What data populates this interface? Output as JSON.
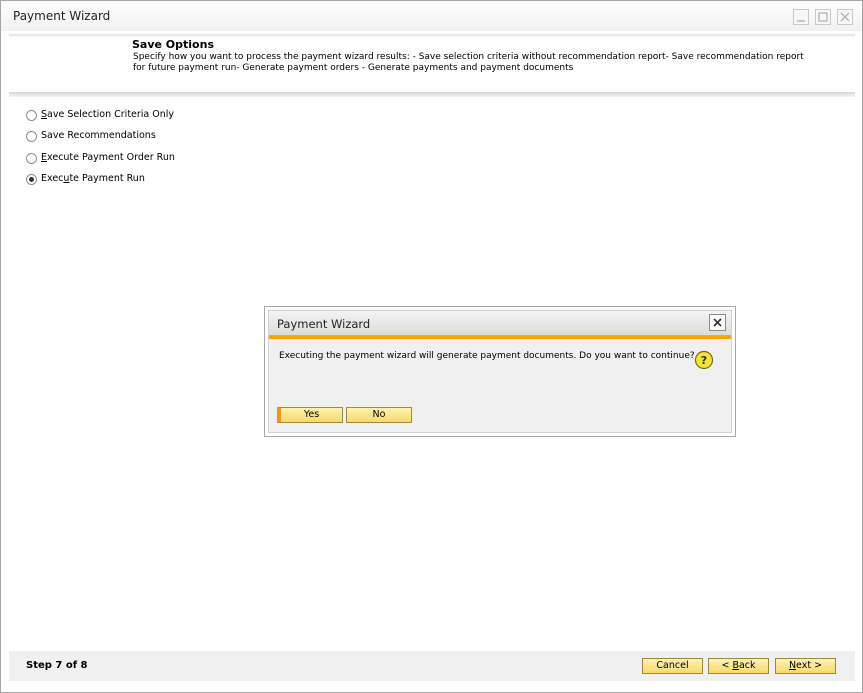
{
  "window": {
    "title": "Payment Wizard"
  },
  "header": {
    "title": "Save Options",
    "description": "Specify how you want to process the payment wizard results: - Save selection criteria without recommendation report- Save recommendation report for future payment run- Generate payment orders - Generate payments and payment documents"
  },
  "options": [
    {
      "label_first": "S",
      "label_rest": "ave Selection Criteria Only",
      "checked": false
    },
    {
      "label_first": "S",
      "label_rest": "ave Recommendations",
      "checked": false
    },
    {
      "label_first": "E",
      "label_rest": "xecute Payment Order Run",
      "checked": false
    },
    {
      "label_pre": "Exec",
      "label_first": "u",
      "label_rest": "te Payment Run",
      "checked": true
    }
  ],
  "footer": {
    "step": "Step 7 of 8",
    "cancel": "Cancel",
    "back_pre": "< ",
    "back_ul": "B",
    "back_rest": "ack",
    "next_ul": "N",
    "next_rest": "ext >"
  },
  "dialog": {
    "title": "Payment Wizard",
    "message": "Executing the payment wizard will generate payment documents. Do you want to continue?",
    "yes": "Yes",
    "no": "No"
  },
  "colors": {
    "accent_orange": "#f39a00",
    "button_yellow": "#f7d86c"
  }
}
